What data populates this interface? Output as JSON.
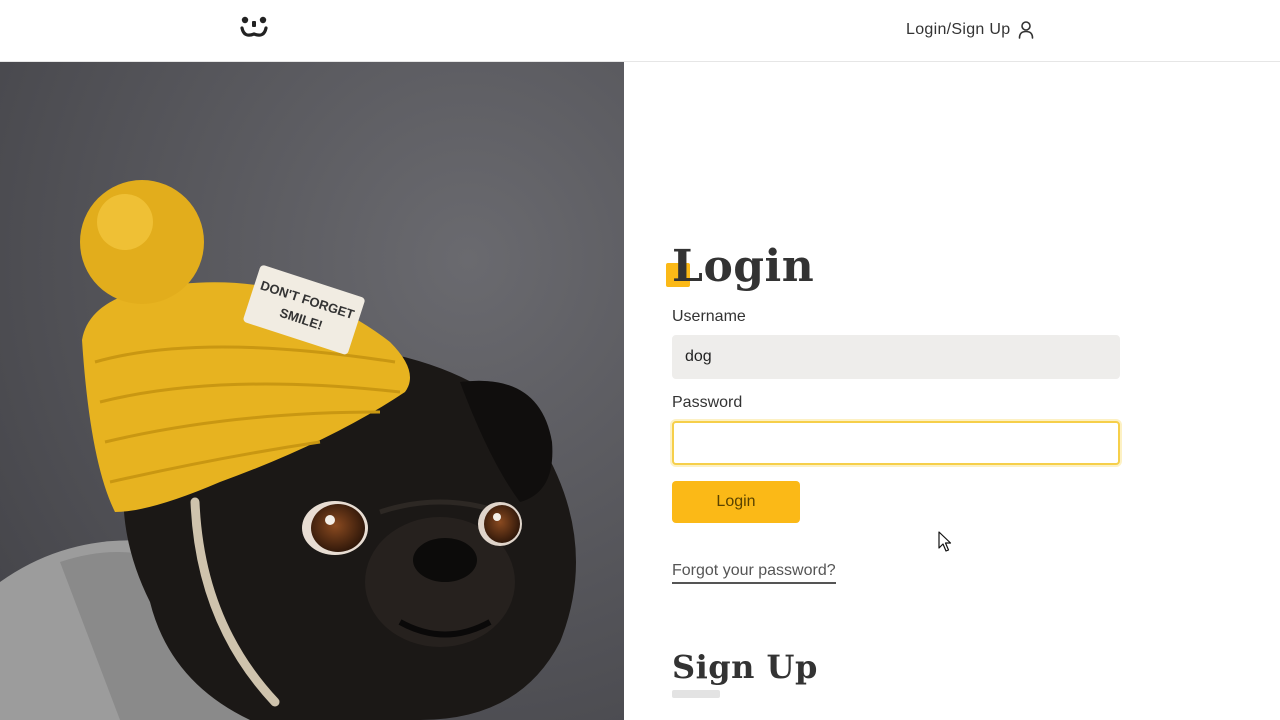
{
  "header": {
    "logo_icon": "smiling-face-logo-icon",
    "nav_link_label": "Login/Sign Up",
    "nav_link_icon": "user-icon"
  },
  "hero": {
    "image": "pug-wearing-yellow-beanie-photo",
    "hat_patch_text": "DON'T FORGET SMILE!"
  },
  "login_form": {
    "title": "Login",
    "username_label": "Username",
    "username_value": "dog",
    "password_label": "Password",
    "password_value": "",
    "submit_label": "Login",
    "forgot_link": "Forgot your password?"
  },
  "signup": {
    "title": "Sign Up"
  },
  "colors": {
    "accent": "#fbb917",
    "field_bg": "#eeedeb",
    "focus_border": "#f6cf4a",
    "text": "#333333"
  }
}
